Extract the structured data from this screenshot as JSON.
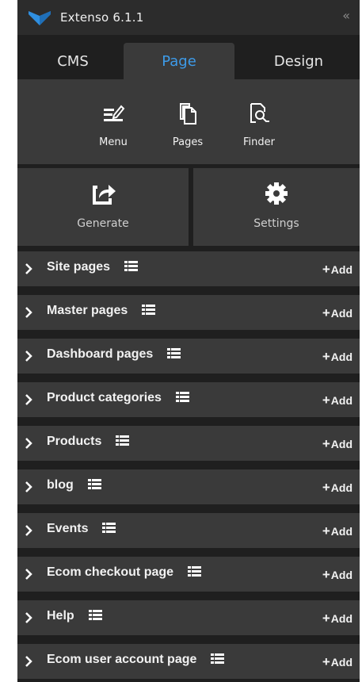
{
  "app": {
    "title": "Extenso 6.1.1",
    "collapse_glyph": "«"
  },
  "tabs": [
    {
      "label": "CMS",
      "active": false
    },
    {
      "label": "Page",
      "active": true
    },
    {
      "label": "Design",
      "active": false
    }
  ],
  "tools": [
    {
      "label": "Menu",
      "icon": "menu-edit-icon"
    },
    {
      "label": "Pages",
      "icon": "pages-copy-icon"
    },
    {
      "label": "Finder",
      "icon": "finder-search-icon"
    }
  ],
  "big_buttons": [
    {
      "label": "Generate",
      "icon": "generate-share-icon"
    },
    {
      "label": "Settings",
      "icon": "gear-icon"
    }
  ],
  "sections": [
    {
      "label": "Site pages",
      "add_label": "Add"
    },
    {
      "label": "Master pages",
      "add_label": "Add"
    },
    {
      "label": "Dashboard pages",
      "add_label": "Add"
    },
    {
      "label": "Product categories",
      "add_label": "Add"
    },
    {
      "label": "Products",
      "add_label": "Add"
    },
    {
      "label": "blog",
      "add_label": "Add"
    },
    {
      "label": "Events",
      "add_label": "Add"
    },
    {
      "label": "Ecom checkout page",
      "add_label": "Add"
    },
    {
      "label": "Help",
      "add_label": "Add"
    },
    {
      "label": "Ecom user account page",
      "add_label": "Add"
    }
  ],
  "colors": {
    "accent": "#3d9be9",
    "panel_bg": "#1f1f1f",
    "surface": "#3a3a3a"
  }
}
